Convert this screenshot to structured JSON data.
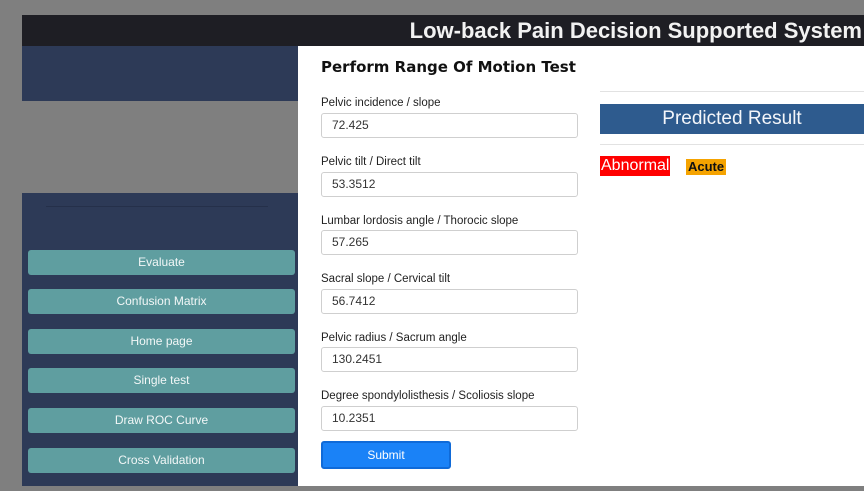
{
  "header": {
    "title": "Low-back Pain Decision Supported System"
  },
  "sidebar": {
    "items": [
      {
        "label": "Evaluate"
      },
      {
        "label": "Confusion Matrix"
      },
      {
        "label": "Home page"
      },
      {
        "label": "Single test"
      },
      {
        "label": "Draw ROC Curve"
      },
      {
        "label": "Cross Validation"
      }
    ]
  },
  "form": {
    "title": "Perform Range Of Motion Test",
    "fields": [
      {
        "label": "Pelvic incidence / slope",
        "value": "72.425"
      },
      {
        "label": "Pelvic tilt / Direct tilt",
        "value": "53.3512"
      },
      {
        "label": "Lumbar lordosis angle / Thorocic slope",
        "value": "57.265"
      },
      {
        "label": "Sacral slope / Cervical tilt",
        "value": "56.7412"
      },
      {
        "label": "Pelvic radius / Sacrum angle",
        "value": "130.2451"
      },
      {
        "label": "Degree spondylolisthesis / Scoliosis slope",
        "value": "10.2351"
      }
    ],
    "submit_label": "Submit"
  },
  "result": {
    "header": "Predicted Result",
    "status": "Abnormal",
    "severity": "Acute"
  },
  "colors": {
    "sidebar_bg": "#2d3a57",
    "nav_button": "#5f9ea0",
    "submit": "#1a82f7",
    "result_header": "#2e5b8e",
    "abnormal": "#ff0000",
    "acute": "#f5a300"
  }
}
